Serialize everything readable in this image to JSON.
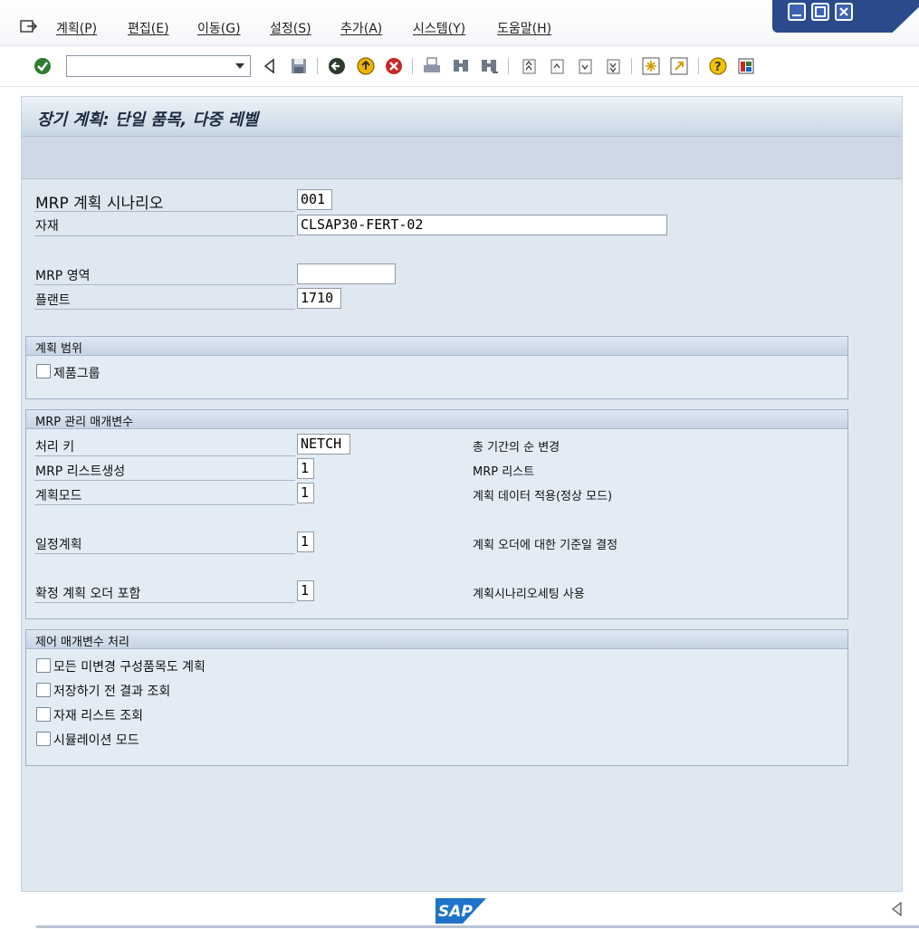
{
  "menu": {
    "items": [
      "계획(P)",
      "편집(E)",
      "이동(G)",
      "설정(S)",
      "추가(A)",
      "시스템(Y)",
      "도움말(H)"
    ]
  },
  "toolbar": {
    "command_field_value": "",
    "icons": [
      "enter-icon",
      "back-icon",
      "save-icon",
      "back-green-icon",
      "exit-icon",
      "cancel-icon",
      "print-icon",
      "find-icon",
      "find-next-icon",
      "first-page-icon",
      "previous-page-icon",
      "next-page-icon",
      "last-page-icon",
      "create-session-icon",
      "shortcut-icon",
      "help-icon",
      "customize-layout-icon"
    ]
  },
  "screen": {
    "title": "장기 계획: 단일 품목, 다중 레벨"
  },
  "header_fields": {
    "scenario_label": "MRP 계획 시나리오",
    "scenario_value": "001",
    "material_label": "자재",
    "material_value": "CLSAP30-FERT-02",
    "mrp_area_label": "MRP 영역",
    "mrp_area_value": "",
    "plant_label": "플랜트",
    "plant_value": "1710"
  },
  "scope_group": {
    "title": "계획 범위",
    "product_group_label": "제품그룹",
    "product_group_checked": false
  },
  "control_group": {
    "title": "MRP 관리 매개변수",
    "rows": [
      {
        "label": "처리 키",
        "value": "NETCH",
        "desc": "총 기간의 순 변경"
      },
      {
        "label": "MRP 리스트생성",
        "value": "1",
        "desc": "MRP 리스트"
      },
      {
        "label": "계획모드",
        "value": "1",
        "desc": "계획 데이터 적용(정상 모드)"
      },
      {
        "label": "일정계획",
        "value": "1",
        "desc": "계획 오더에 대한 기준일 결정"
      },
      {
        "label": "확정 계획 오더 포함",
        "value": "1",
        "desc": "계획시나리오세팅 사용"
      }
    ]
  },
  "processing_group": {
    "title": "제어 매개변수 처리",
    "options": [
      {
        "label": "모든 미변경 구성품목도 계획",
        "checked": false
      },
      {
        "label": "저장하기 전 결과 조회",
        "checked": false
      },
      {
        "label": "자재 리스트 조회",
        "checked": false
      },
      {
        "label": "시뮬레이션 모드",
        "checked": false
      }
    ]
  },
  "footer": {
    "logo_text": "SAP"
  },
  "colors": {
    "pane_bg": "#dfe8f1",
    "title_bar": "#c9d7e5",
    "window_controls": "#2a4a8c",
    "sap_logo": "#1e73c9"
  }
}
